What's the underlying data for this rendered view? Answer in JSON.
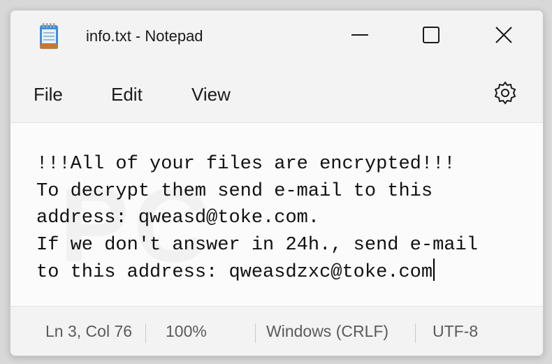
{
  "window": {
    "title": "info.txt - Notepad",
    "icon": "notepad-icon",
    "controls": {
      "minimize_icon": "minimize-icon",
      "maximize_icon": "maximize-icon",
      "close_icon": "close-icon"
    }
  },
  "menu": {
    "items": [
      {
        "label": "File"
      },
      {
        "label": "Edit"
      },
      {
        "label": "View"
      }
    ],
    "settings_icon": "gear-icon"
  },
  "editor": {
    "lines": [
      "!!!All of your files are encrypted!!!",
      "To decrypt them send e-mail to this",
      "address: qweasd@toke.com.",
      "If we don't answer in 24h., send e-mail",
      "to this address: qweasdzxc@toke.com"
    ]
  },
  "status": {
    "position": "Ln 3, Col 76",
    "zoom": "100%",
    "line_ending": "Windows (CRLF)",
    "encoding": "UTF-8"
  },
  "colors": {
    "window_bg": "#f3f3f3",
    "editor_bg": "#fbfbfb",
    "text": "#111111",
    "status_text": "#5a5a5a"
  }
}
